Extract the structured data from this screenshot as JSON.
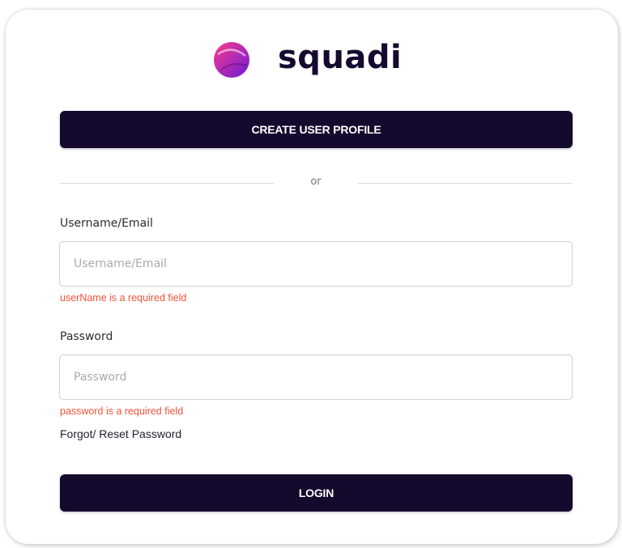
{
  "brand": {
    "name": "squadi",
    "logo_icon": "squadi-ball-icon",
    "colors": {
      "primary": "#150a2e",
      "logo_gradient_start": "#ff3a8c",
      "logo_gradient_end": "#6a1bd6",
      "error": "#f0533a"
    }
  },
  "actions": {
    "create_label": "CREATE USER PROFILE",
    "login_label": "LOGIN"
  },
  "divider": {
    "text": "or"
  },
  "form": {
    "username": {
      "label": "Username/Email",
      "placeholder": "Username/Email",
      "value": "",
      "error": "userName is a required field"
    },
    "password": {
      "label": "Password",
      "placeholder": "Password",
      "value": "",
      "error": "password is a required field"
    },
    "forgot_link": "Forgot/ Reset Password"
  }
}
